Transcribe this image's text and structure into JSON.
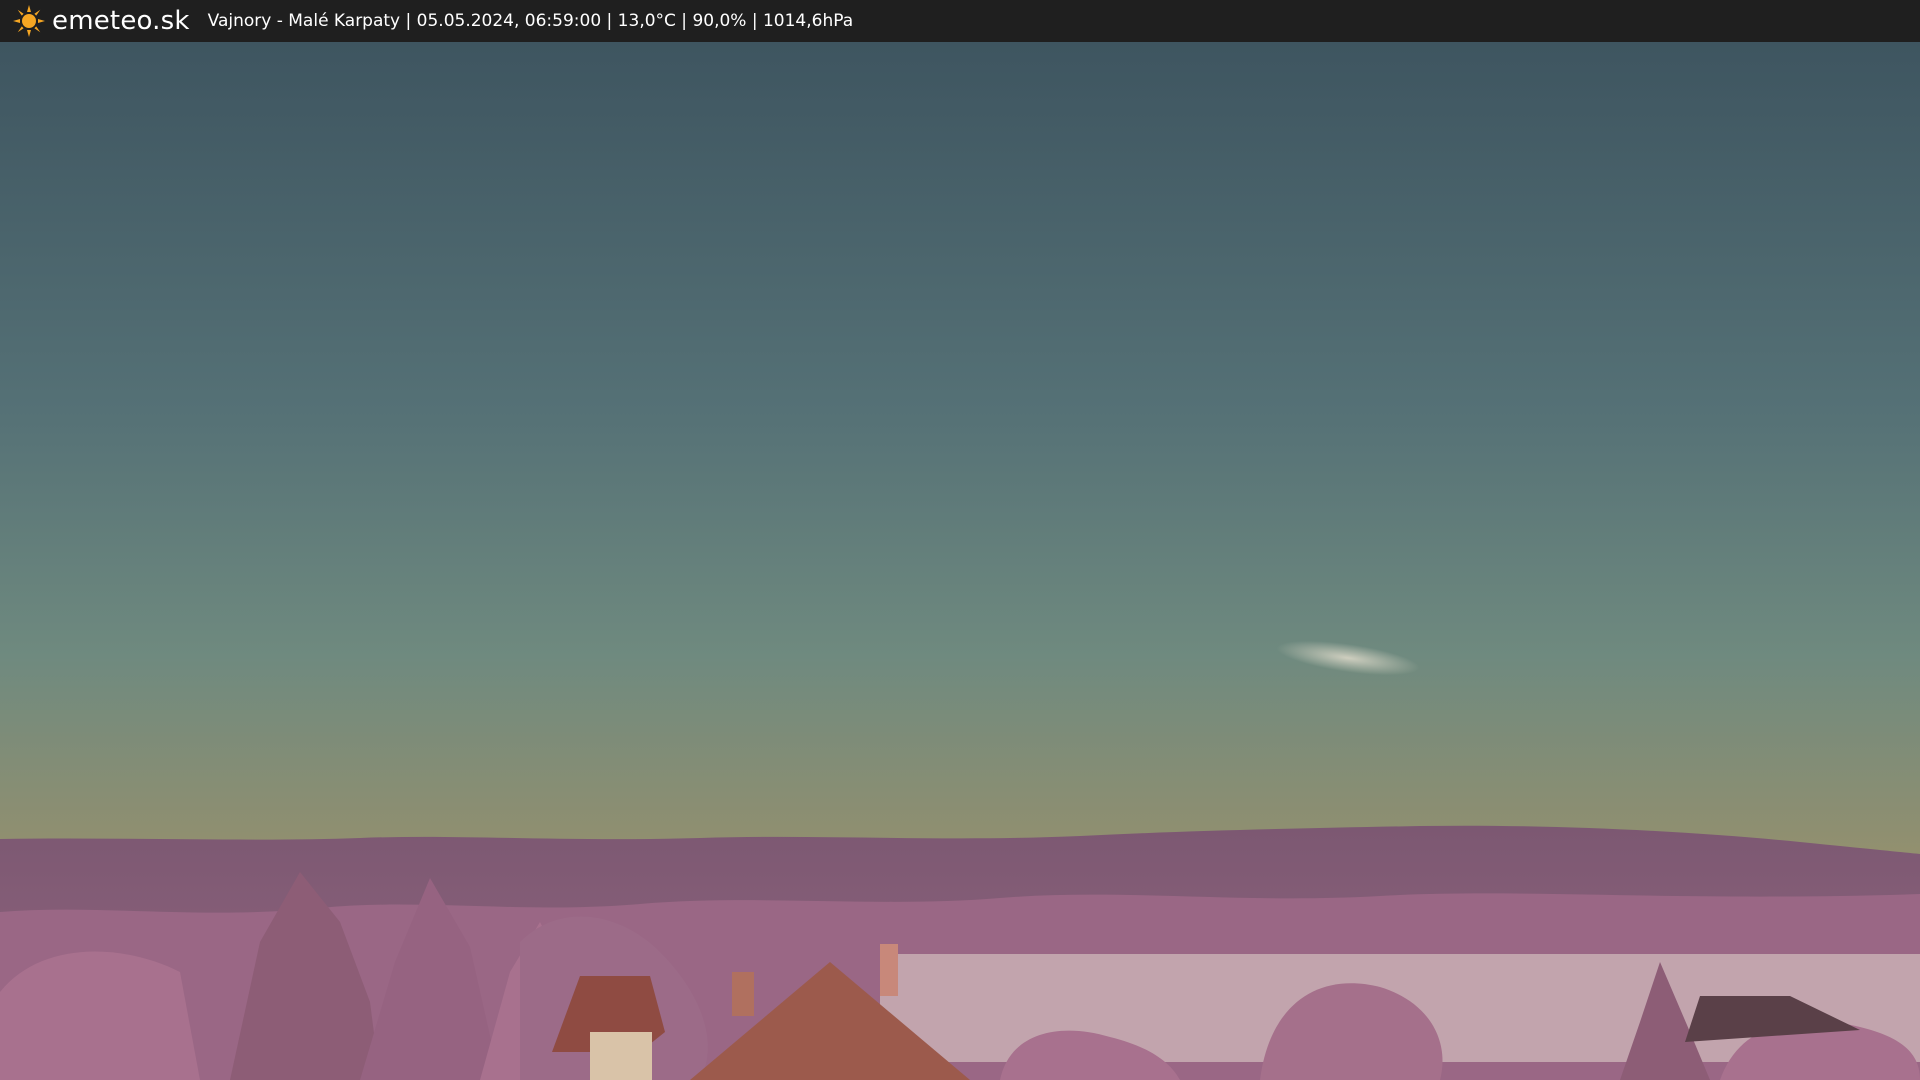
{
  "header": {
    "brand": "emeteo.sk",
    "caption": "Vajnory - Malé Karpaty | 05.05.2024, 06:59:00 | 13,0°C | 90,0% | 1014,6hPa",
    "logo_icon": "sun-icon",
    "colors": {
      "bar": "#1f1f1f",
      "text": "#ffffff",
      "sun": "#f5a623"
    }
  },
  "webcam": {
    "colors": {
      "sky_top": "#3e5560",
      "sky_mid": "#5e7a7c",
      "sky_horizon": "#94906e",
      "hills": "#8a5f79",
      "trees": "#a8718e",
      "field": "#c2a4ad",
      "roof": "#9c5a4c"
    }
  }
}
